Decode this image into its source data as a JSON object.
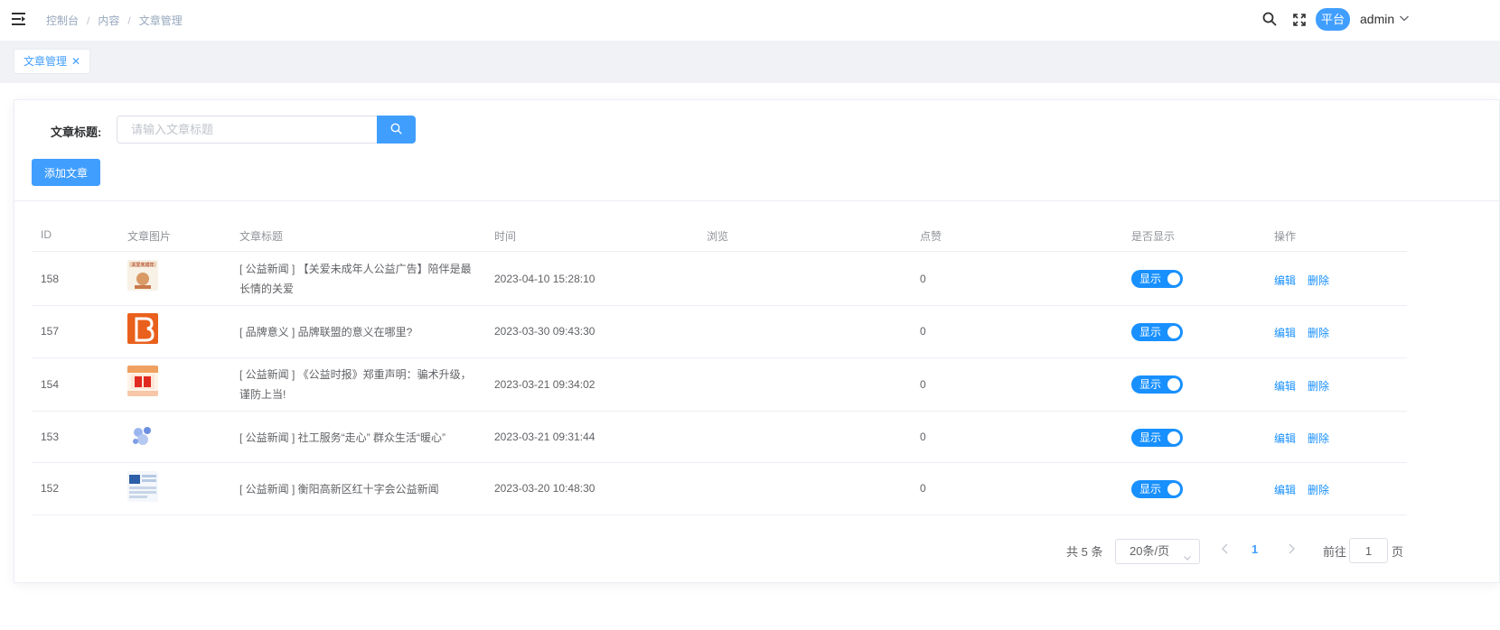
{
  "header": {
    "breadcrumb": [
      "控制台",
      "内容",
      "文章管理"
    ],
    "platform_label": "平台",
    "user_name": "admin"
  },
  "tags": [
    {
      "label": "文章管理"
    }
  ],
  "filter": {
    "title_label": "文章标题:",
    "title_placeholder": "请输入文章标题",
    "title_value": ""
  },
  "toolbar": {
    "add_label": "添加文章"
  },
  "table": {
    "columns": [
      "ID",
      "文章图片",
      "文章标题",
      "时间",
      "浏览",
      "点赞",
      "是否显示",
      "操作"
    ],
    "rows": [
      {
        "id": "158",
        "title": "[ 公益新闻 ] 【关爱未成年人公益广告】陪伴是最长情的关爱",
        "time": "2023-04-10 15:28:10",
        "views": "",
        "likes": "0",
        "show": "显示",
        "edit": "编辑",
        "delete": "删除"
      },
      {
        "id": "157",
        "title": "[ 品牌意义 ] 品牌联盟的意义在哪里?",
        "time": "2023-03-30 09:43:30",
        "views": "",
        "likes": "0",
        "show": "显示",
        "edit": "编辑",
        "delete": "删除"
      },
      {
        "id": "154",
        "title": "[ 公益新闻 ] 《公益时报》郑重声明：骗术升级，谨防上当!",
        "time": "2023-03-21 09:34:02",
        "views": "",
        "likes": "0",
        "show": "显示",
        "edit": "编辑",
        "delete": "删除"
      },
      {
        "id": "153",
        "title": "[ 公益新闻 ] 社工服务“走心” 群众生活“暖心”",
        "time": "2023-03-21 09:31:44",
        "views": "",
        "likes": "0",
        "show": "显示",
        "edit": "编辑",
        "delete": "删除"
      },
      {
        "id": "152",
        "title": "[ 公益新闻 ] 衡阳高新区红十字会公益新闻",
        "time": "2023-03-20 10:48:30",
        "views": "",
        "likes": "0",
        "show": "显示",
        "edit": "编辑",
        "delete": "删除"
      }
    ]
  },
  "pagination": {
    "total_text": "共 5 条",
    "page_size": "20条/页",
    "current_page": "1",
    "goto_label": "前往",
    "goto_value": "1",
    "page_suffix": "页"
  },
  "colors": {
    "primary": "#409eff",
    "switch_on": "#1890ff",
    "link": "#1890ff"
  }
}
